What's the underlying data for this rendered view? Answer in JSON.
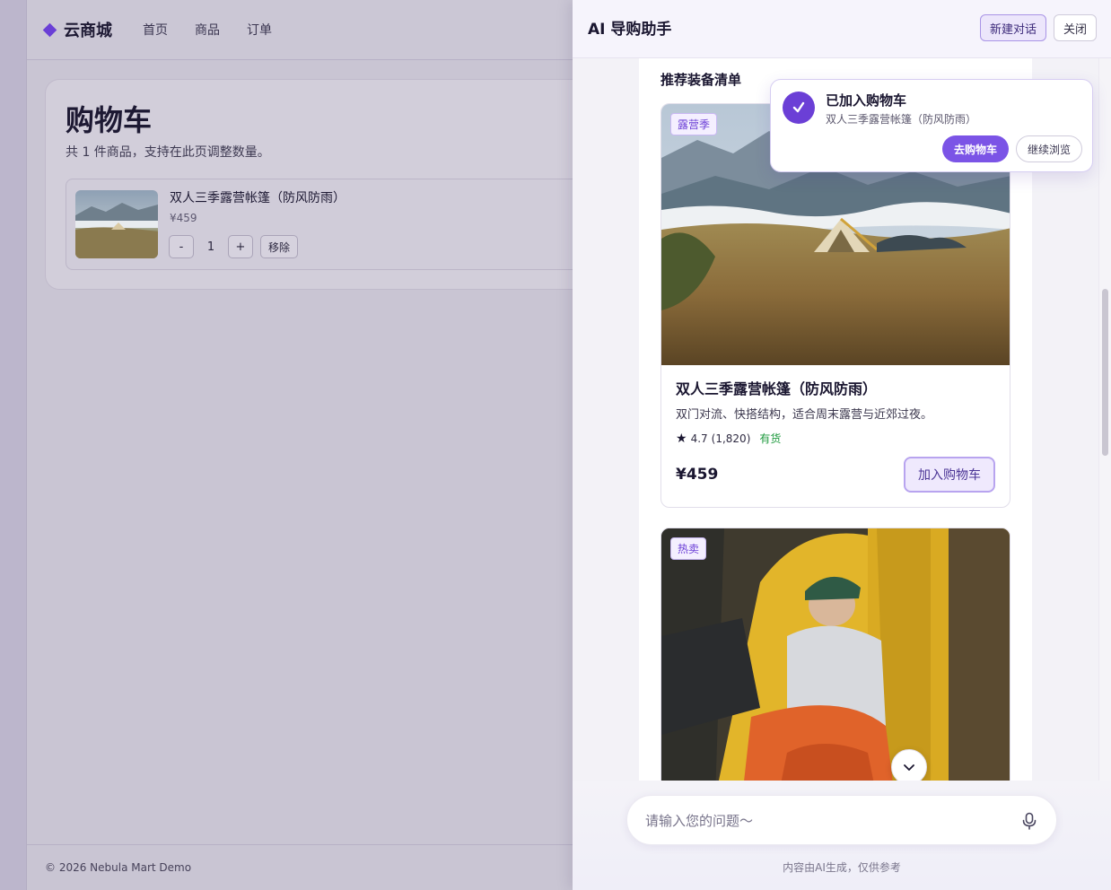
{
  "site": {
    "brand": "云商城",
    "nav": [
      "首页",
      "商品",
      "订单"
    ],
    "footer": "© 2026 Nebula Mart Demo"
  },
  "cart": {
    "title": "购物车",
    "subtitle": "共 1 件商品，支持在此页调整数量。",
    "item": {
      "name": "双人三季露营帐篷（防风防雨）",
      "price": "¥459",
      "minus": "-",
      "qty": "1",
      "plus": "+",
      "remove": "移除"
    }
  },
  "panel": {
    "title": "AI 导购助手",
    "new_chat": "新建对话",
    "close": "关闭",
    "section_title": "推荐装备清单",
    "products": [
      {
        "tag": "露营季",
        "name": "双人三季露营帐篷（防风防雨）",
        "desc": "双门对流、快搭结构，适合周末露营与近郊过夜。",
        "rating": "4.7",
        "reviews": "(1,820)",
        "stock": "有货",
        "price": "¥459",
        "add_label": "加入购物车"
      },
      {
        "tag": "热卖"
      }
    ],
    "toast": {
      "title": "已加入购物车",
      "subtitle": "双人三季露营帐篷（防风防雨）",
      "go_cart": "去购物车",
      "continue": "继续浏览"
    },
    "input_placeholder": "请输入您的问题～",
    "disclaimer": "内容由AI生成，仅供参考"
  },
  "colors": {
    "accent": "#6b3fd6",
    "accent_light": "#efe9fd",
    "stock_green": "#1e9a3e"
  },
  "icons": [
    "diamond-logo-icon",
    "check-icon",
    "star-icon",
    "chevron-down-icon",
    "microphone-icon"
  ]
}
